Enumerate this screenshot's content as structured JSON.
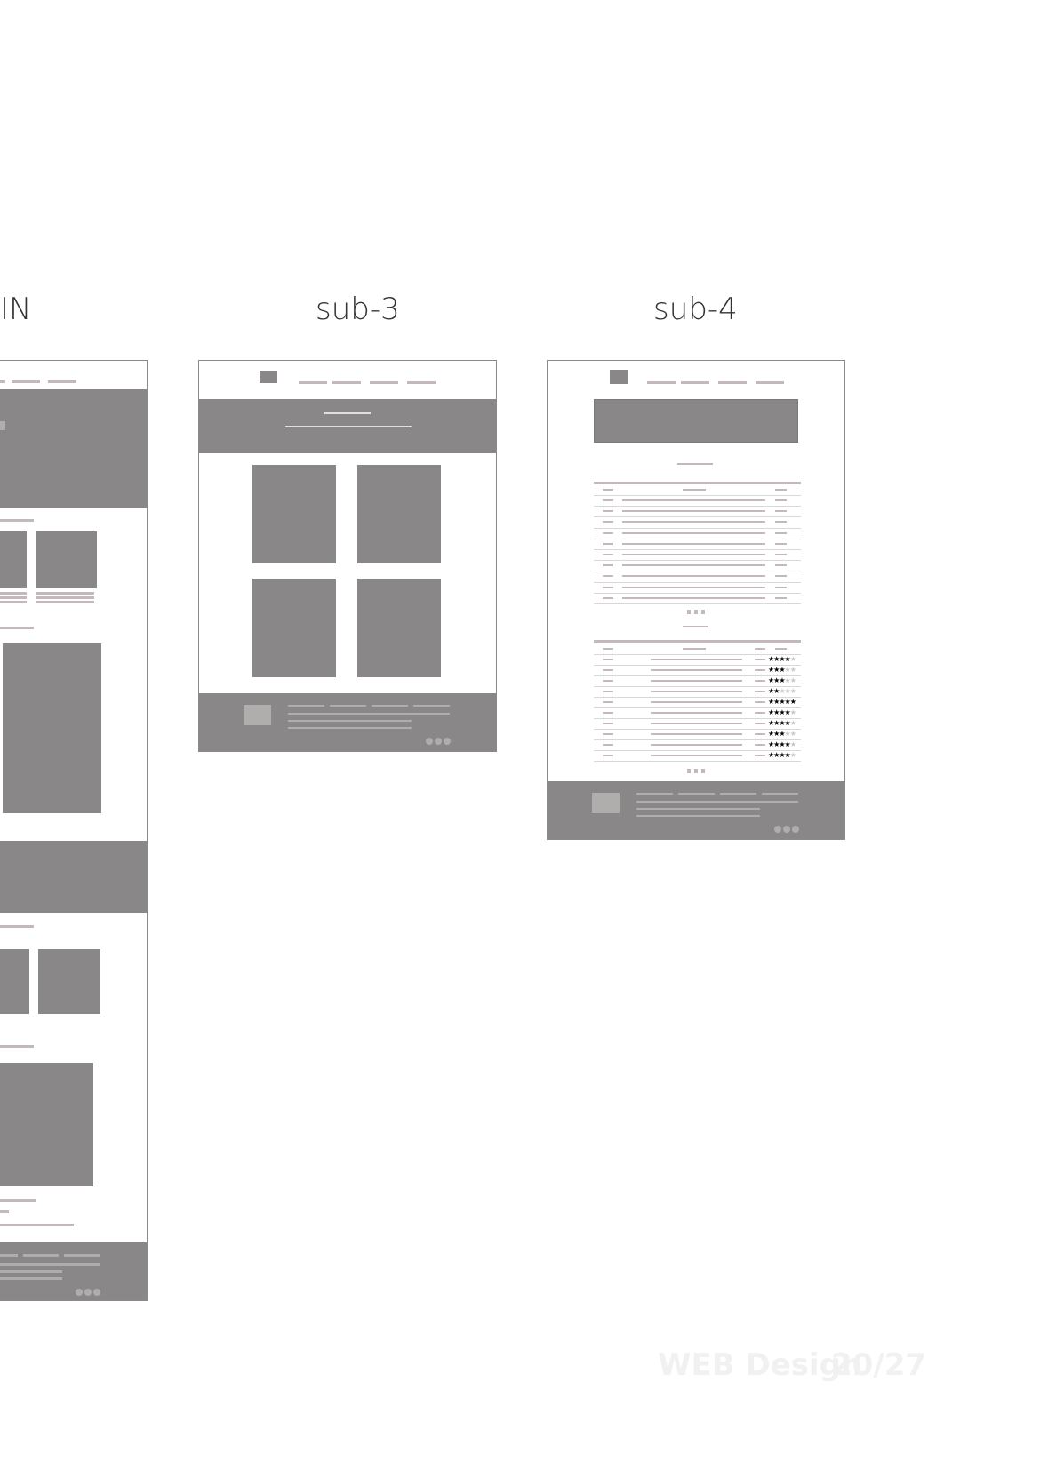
{
  "labels": {
    "main": "IN",
    "sub3": "sub-3",
    "sub4": "sub-4"
  },
  "watermark": {
    "left": "WEB Design",
    "right": "20/27"
  },
  "colors": {
    "block": "#898787",
    "line": "#c4b8bc",
    "line_light": "#e3dfe0",
    "frame_border": "#8a8a8a",
    "star_on": "#000000",
    "star_off": "#c8c8c8"
  },
  "ratings": {
    "max": 5,
    "values": [
      4,
      3,
      3,
      2,
      5,
      4,
      4,
      3,
      4,
      4
    ]
  }
}
